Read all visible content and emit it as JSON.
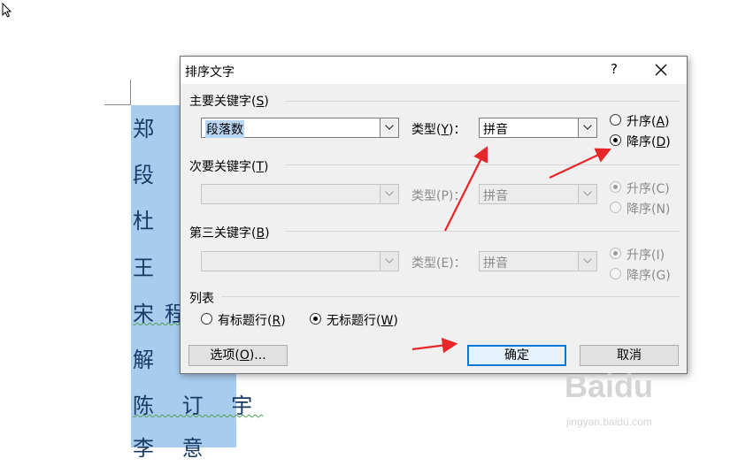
{
  "document": {
    "lines": [
      {
        "text": "郑 一",
        "squiggle": false
      },
      {
        "text": "段",
        "squiggle": false
      },
      {
        "text": "杜 等",
        "squiggle": false
      },
      {
        "text": "王",
        "squiggle": false
      },
      {
        "text": "宋程",
        "squiggle": true
      },
      {
        "text": "解",
        "squiggle": false
      },
      {
        "text": "陈 订 宇",
        "squiggle": true
      },
      {
        "text": "李     意",
        "squiggle": false
      }
    ]
  },
  "dialog": {
    "title": "排序文字",
    "help_label": "?",
    "primary_key": {
      "label": "主要关键字(",
      "accel": "S",
      "label_end": ")",
      "value": "段落数",
      "type_label": "类型(",
      "type_accel": "Y",
      "type_label_end": ")：",
      "type_value": "拼音",
      "asc_label": "升序(",
      "asc_accel": "A",
      "asc_end": ")",
      "desc_label": "降序(",
      "desc_accel": "D",
      "desc_end": ")",
      "selected": "desc"
    },
    "secondary_key": {
      "label": "次要关键字(",
      "accel": "T",
      "label_end": ")",
      "value": "",
      "type_label": "类型(P)：",
      "type_value": "拼音",
      "asc_label": "升序(C)",
      "desc_label": "降序(N)",
      "selected": "asc"
    },
    "third_key": {
      "label": "第三关键字(",
      "accel": "B",
      "label_end": ")",
      "value": "",
      "type_label": "类型(E)：",
      "type_value": "拼音",
      "asc_label": "升序(I)",
      "desc_label": "降序(G)",
      "selected": "asc"
    },
    "list": {
      "label": "列表",
      "header_label": "有标题行(",
      "header_accel": "R",
      "header_end": ")",
      "no_header_label": "无标题行(",
      "no_header_accel": "W",
      "no_header_end": ")",
      "selected": "no_header"
    },
    "buttons": {
      "options": "选项(",
      "options_accel": "O",
      "options_end": ")...",
      "ok": "确定",
      "cancel": "取消"
    }
  },
  "annotation_color": "#e8262a",
  "watermark": {
    "logo": "Baidu",
    "url": "jingyan.baidu.com"
  }
}
